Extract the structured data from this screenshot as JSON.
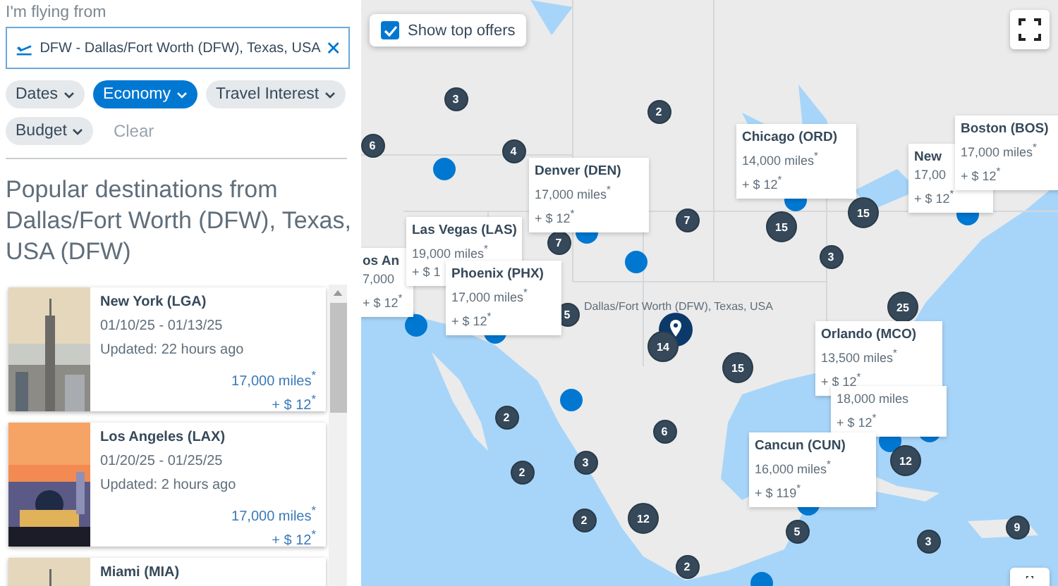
{
  "origin": {
    "label": "I'm flying from",
    "value": "DFW - Dallas/Fort Worth (DFW), Texas, USA"
  },
  "filters": [
    {
      "label": "Dates",
      "selected": false
    },
    {
      "label": "Economy",
      "selected": true
    },
    {
      "label": "Travel Interest",
      "selected": false
    },
    {
      "label": "Budget",
      "selected": false
    }
  ],
  "clear": "Clear",
  "heading": "Popular destinations from Dallas/Fort Worth (DFW), Texas, USA (DFW)",
  "destinations": [
    {
      "city": "New York (LGA)",
      "dates": "01/10/25 - 01/13/25",
      "updated": "Updated: 22 hours ago",
      "miles": "17,000 miles$^{*}$",
      "fee": "+ $ 12$^{*}$"
    },
    {
      "city": "Los Angeles (LAX)",
      "dates": "01/20/25 - 01/25/25",
      "updated": "Updated: 2 hours ago",
      "miles": "17,000 miles$^{*}$",
      "fee": "+ $ 12$^{*}$"
    },
    {
      "city": "Miami (MIA)"
    }
  ],
  "map": {
    "top_offers": {
      "label": "Show top offers",
      "checked": true
    },
    "origin_label": "Dallas/Fort Worth (DFW), Texas, USA",
    "clusters": [
      "3",
      "2",
      "6",
      "4",
      "7",
      "7",
      "15",
      "15",
      "3",
      "5",
      "14",
      "25",
      "15",
      "2",
      "6",
      "3",
      "2",
      "2",
      "12",
      "2",
      "12",
      "5",
      "3",
      "9"
    ],
    "offers": [
      {
        "title": "os An",
        "miles": "7,000",
        "fee": "+ $ 12$^{*}$"
      },
      {
        "title": "Las Vegas (LAS)",
        "miles": "19,000 miles$^{*}$",
        "fee": "+ $ 1"
      },
      {
        "title": "Phoenix (PHX)",
        "miles": "17,000 miles$^{*}$",
        "fee": "+ $ 12$^{*}$"
      },
      {
        "title": "Denver (DEN)",
        "miles": "17,000 miles$^{*}$",
        "fee": "+ $ 12$^{*}$"
      },
      {
        "title": "Chicago (ORD)",
        "miles": "14,000 miles$^{*}$",
        "fee": "+ $ 12$^{*}$"
      },
      {
        "title": "New",
        "miles": "17,00",
        "fee": "+ $ 12$^{*}$"
      },
      {
        "title": "Boston (BOS)",
        "miles": "17,000 miles$^{*}$",
        "fee": "+ $ 12$^{*}$"
      },
      {
        "title": "Orlando (MCO)",
        "miles": "13,500 miles$^{*}$",
        "fee": "+ $ 12$^{*}$"
      },
      {
        "miles": "18,000 miles",
        "fee": "+ $ 12$^{*}$"
      },
      {
        "title": "Cancun (CUN)",
        "miles": "16,000 miles$^{*}$",
        "fee": "+ $ 119$^{*}$"
      }
    ]
  }
}
